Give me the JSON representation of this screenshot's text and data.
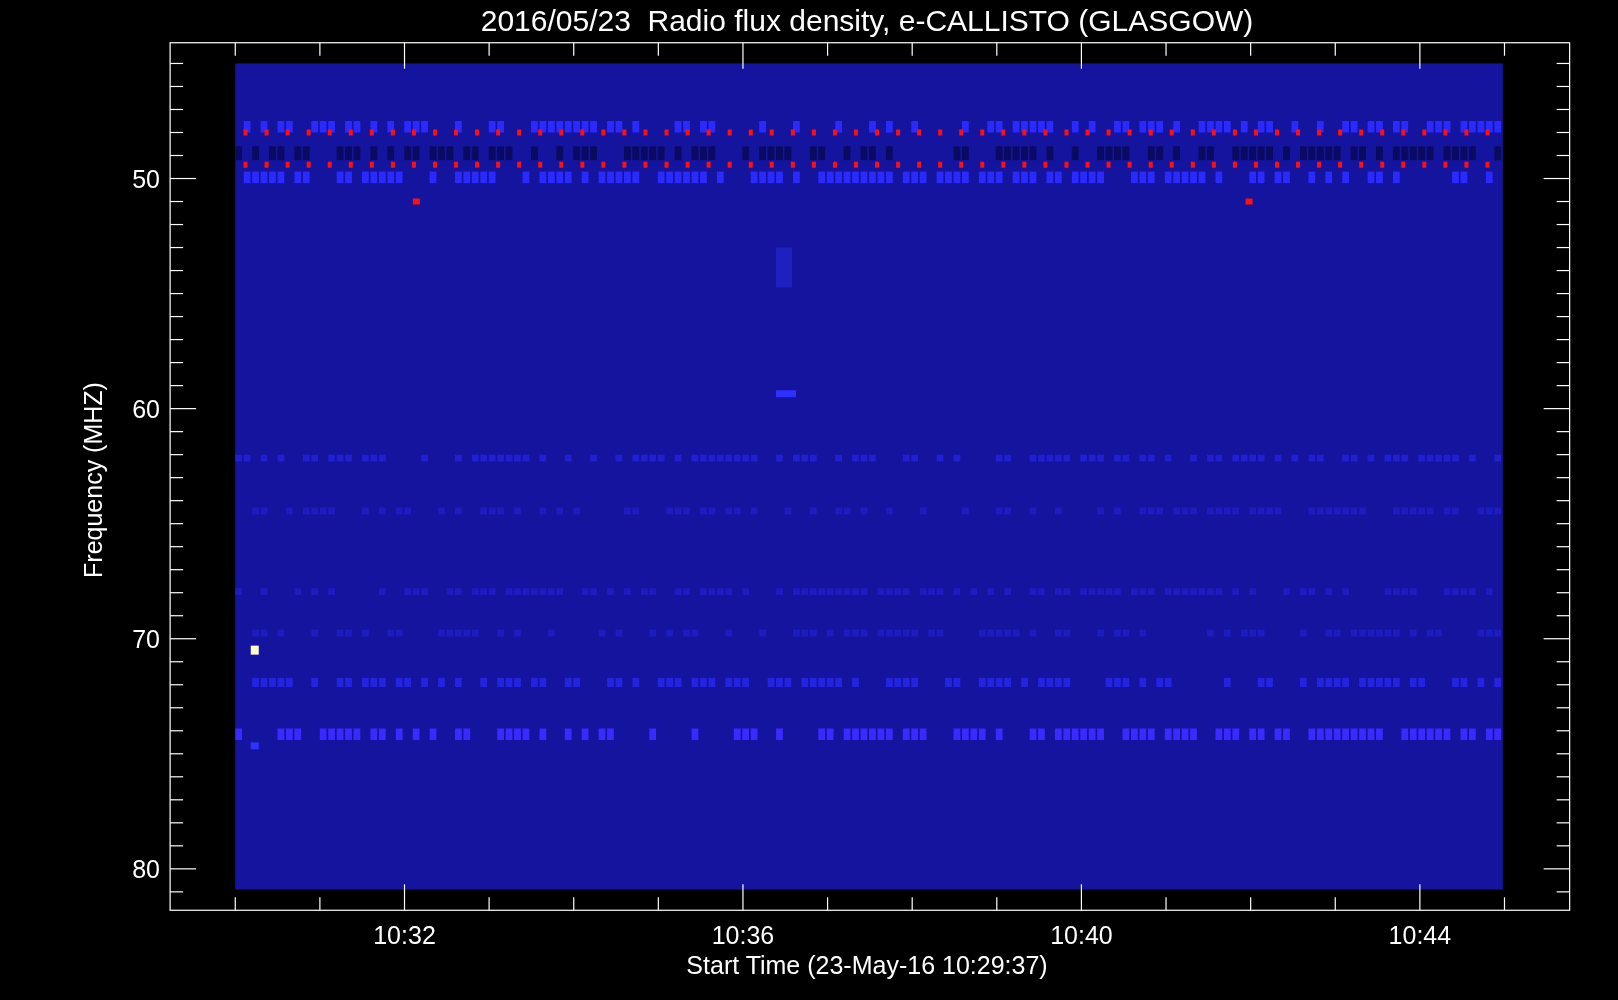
{
  "title": "2016/05/23  Radio flux density, e-CALLISTO (GLASGOW)",
  "y_axis": {
    "label": "Frequency (MHZ)",
    "ticks": [
      "50",
      "60",
      "70",
      "80"
    ]
  },
  "x_axis": {
    "label": "Start Time (23-May-16 10:29:37)",
    "ticks": [
      "10:32",
      "10:36",
      "10:40",
      "10:44"
    ]
  }
}
